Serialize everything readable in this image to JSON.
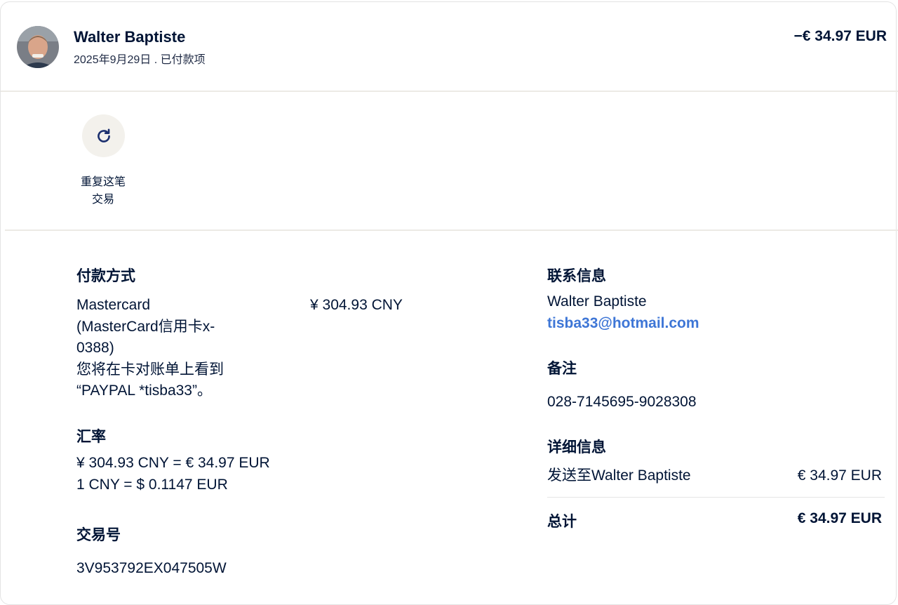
{
  "header": {
    "name": "Walter Baptiste",
    "subline": "2025年9月29日 . 已付款项",
    "amount": "−€ 34.97 EUR"
  },
  "repeat": {
    "label_line1": "重复这笔",
    "label_line2": "交易"
  },
  "payment": {
    "heading": "付款方式",
    "line1": "Mastercard",
    "line2": "(MasterCard信用卡x-",
    "line3": "0388)",
    "line4": "您将在卡对账单上看到",
    "line5": "“PAYPAL *tisba33”。",
    "amount": "¥ 304.93 CNY"
  },
  "exchange": {
    "heading": "汇率",
    "line1": "¥ 304.93 CNY = € 34.97 EUR",
    "line2": "1 CNY = $ 0.1147 EUR"
  },
  "transaction": {
    "heading": "交易号",
    "id": "3V953792EX047505W"
  },
  "contact": {
    "heading": "联系信息",
    "name": "Walter Baptiste",
    "email": "tisba33@hotmail.com"
  },
  "note": {
    "heading": "备注",
    "value": "028-7145695-9028308"
  },
  "details": {
    "heading": "详细信息",
    "sent_label": "发送至Walter Baptiste",
    "sent_amount": "€ 34.97 EUR",
    "total_label": "总计",
    "total_amount": "€ 34.97 EUR"
  },
  "icons": {
    "avatar": "avatar-photo",
    "repeat": "refresh-icon"
  }
}
